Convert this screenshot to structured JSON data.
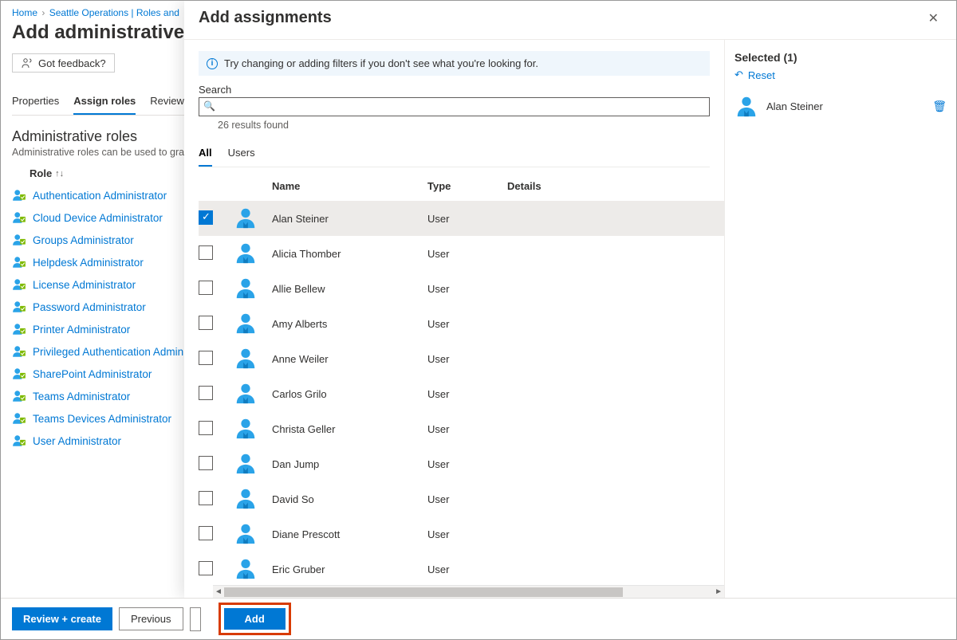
{
  "breadcrumb": {
    "home": "Home",
    "mid": "Seattle Operations | Roles and"
  },
  "page": {
    "title": "Add administrative uni",
    "feedback": "Got feedback?"
  },
  "tabs": {
    "properties": "Properties",
    "assign": "Assign roles",
    "review": "Review"
  },
  "section": {
    "title": "Administrative roles",
    "sub": "Administrative roles can be used to grant"
  },
  "col": {
    "role": "Role"
  },
  "roles": [
    "Authentication Administrator",
    "Cloud Device Administrator",
    "Groups Administrator",
    "Helpdesk Administrator",
    "License Administrator",
    "Password Administrator",
    "Printer Administrator",
    "Privileged Authentication Administ",
    "SharePoint Administrator",
    "Teams Administrator",
    "Teams Devices Administrator",
    "User Administrator"
  ],
  "footer": {
    "review": "Review + create",
    "prev": "Previous",
    "add": "Add"
  },
  "panel": {
    "title": "Add assignments",
    "info": "Try changing or adding filters if you don't see what you're looking for.",
    "search_label": "Search",
    "results": "26 results found",
    "tab_all": "All",
    "tab_users": "Users",
    "head_name": "Name",
    "head_type": "Type",
    "head_details": "Details",
    "side_title": "Selected (1)",
    "reset": "Reset",
    "selected_name": "Alan Steiner"
  },
  "users": [
    {
      "name": "Alan Steiner",
      "type": "User",
      "selected": true
    },
    {
      "name": "Alicia Thomber",
      "type": "User",
      "selected": false
    },
    {
      "name": "Allie Bellew",
      "type": "User",
      "selected": false
    },
    {
      "name": "Amy Alberts",
      "type": "User",
      "selected": false
    },
    {
      "name": "Anne Weiler",
      "type": "User",
      "selected": false
    },
    {
      "name": "Carlos Grilo",
      "type": "User",
      "selected": false
    },
    {
      "name": "Christa Geller",
      "type": "User",
      "selected": false
    },
    {
      "name": "Dan Jump",
      "type": "User",
      "selected": false
    },
    {
      "name": "David So",
      "type": "User",
      "selected": false
    },
    {
      "name": "Diane Prescott",
      "type": "User",
      "selected": false
    },
    {
      "name": "Eric Gruber",
      "type": "User",
      "selected": false
    }
  ]
}
